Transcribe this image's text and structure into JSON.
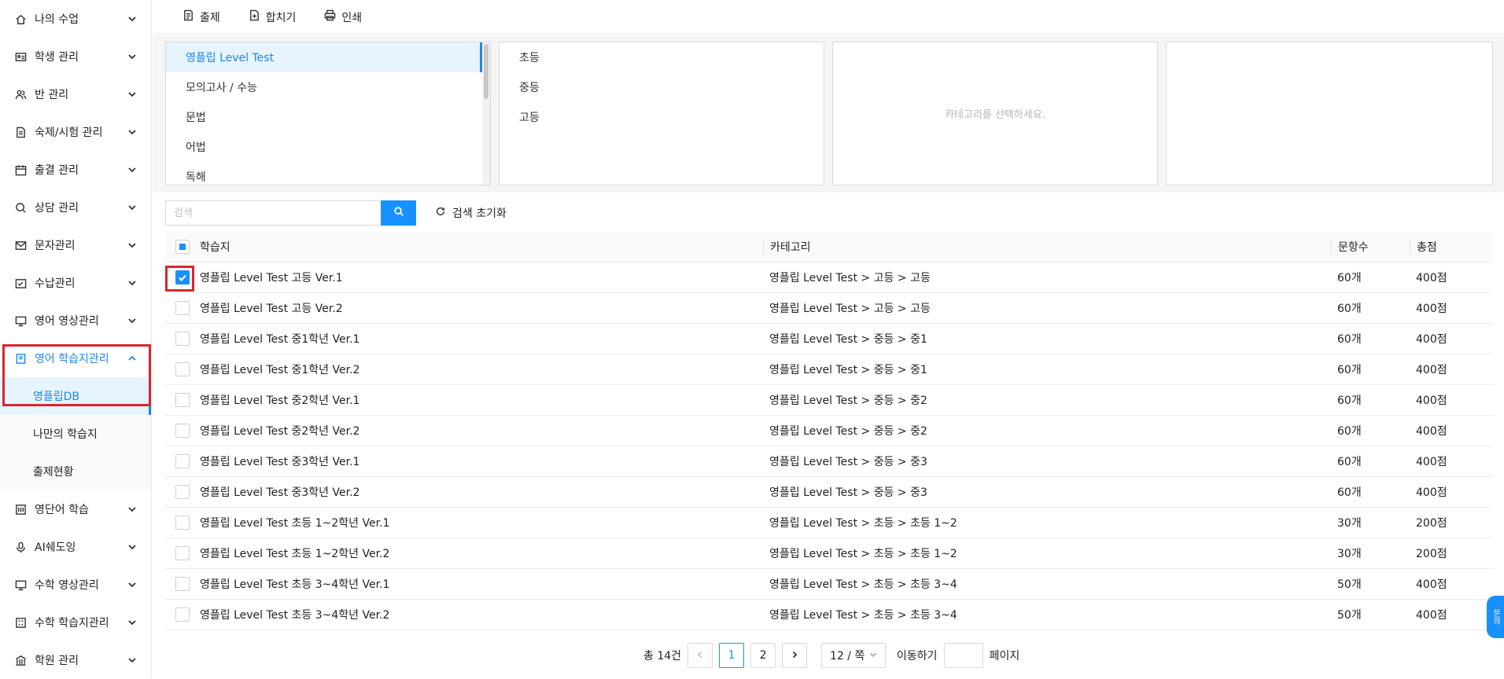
{
  "sidebar": {
    "items": [
      {
        "label": "나의 수업",
        "icon": "home-icon"
      },
      {
        "label": "학생 관리",
        "icon": "id-card-icon"
      },
      {
        "label": "반 관리",
        "icon": "users-icon"
      },
      {
        "label": "숙제/시험 관리",
        "icon": "document-icon"
      },
      {
        "label": "출결 관리",
        "icon": "calendar-icon"
      },
      {
        "label": "상담 관리",
        "icon": "chat-icon"
      },
      {
        "label": "문자관리",
        "icon": "mail-icon"
      },
      {
        "label": "수납관리",
        "icon": "wallet-icon"
      },
      {
        "label": "영어 영상관리",
        "icon": "monitor-icon"
      },
      {
        "label": "영어 학습지관리",
        "icon": "book-icon"
      },
      {
        "label": "영단어 학습",
        "icon": "vocab-icon"
      },
      {
        "label": "AI쉐도잉",
        "icon": "mic-icon"
      },
      {
        "label": "수학 영상관리",
        "icon": "monitor-icon"
      },
      {
        "label": "수학 학습지관리",
        "icon": "calculator-icon"
      },
      {
        "label": "학원 관리",
        "icon": "building-icon"
      }
    ],
    "sub_items": [
      "영플립DB",
      "나만의 학습지",
      "출제현황"
    ]
  },
  "toolbar": {
    "submit_label": "출제",
    "merge_label": "합치기",
    "print_label": "인쇄"
  },
  "categories": {
    "level1": [
      "영플립 Level Test",
      "모의고사 / 수능",
      "문법",
      "어법",
      "독해"
    ],
    "level2": [
      "초등",
      "중등",
      "고등"
    ],
    "empty_message": "카테고리를 선택하세요."
  },
  "search": {
    "placeholder": "검색",
    "reset_label": "검색 초기화"
  },
  "table": {
    "headers": {
      "name": "학습지",
      "category": "카테고리",
      "count": "문항수",
      "score": "총점"
    },
    "rows": [
      {
        "name": "영플립 Level Test 고등 Ver.1",
        "category": "영플립 Level Test > 고등 > 고등",
        "count": "60개",
        "score": "400점",
        "checked": true
      },
      {
        "name": "영플립 Level Test 고등 Ver.2",
        "category": "영플립 Level Test > 고등 > 고등",
        "count": "60개",
        "score": "400점",
        "checked": false
      },
      {
        "name": "영플립 Level Test 중1학년 Ver.1",
        "category": "영플립 Level Test > 중등 > 중1",
        "count": "60개",
        "score": "400점",
        "checked": false
      },
      {
        "name": "영플립 Level Test 중1학년 Ver.2",
        "category": "영플립 Level Test > 중등 > 중1",
        "count": "60개",
        "score": "400점",
        "checked": false
      },
      {
        "name": "영플립 Level Test 중2학년 Ver.1",
        "category": "영플립 Level Test > 중등 > 중2",
        "count": "60개",
        "score": "400점",
        "checked": false
      },
      {
        "name": "영플립 Level Test 중2학년 Ver.2",
        "category": "영플립 Level Test > 중등 > 중2",
        "count": "60개",
        "score": "400점",
        "checked": false
      },
      {
        "name": "영플립 Level Test 중3학년 Ver.1",
        "category": "영플립 Level Test > 중등 > 중3",
        "count": "60개",
        "score": "400점",
        "checked": false
      },
      {
        "name": "영플립 Level Test 중3학년 Ver.2",
        "category": "영플립 Level Test > 중등 > 중3",
        "count": "60개",
        "score": "400점",
        "checked": false
      },
      {
        "name": "영플립 Level Test 초등 1~2학년 Ver.1",
        "category": "영플립 Level Test > 초등 > 초등 1~2",
        "count": "30개",
        "score": "200점",
        "checked": false
      },
      {
        "name": "영플립 Level Test 초등 1~2학년 Ver.2",
        "category": "영플립 Level Test > 초등 > 초등 1~2",
        "count": "30개",
        "score": "200점",
        "checked": false
      },
      {
        "name": "영플립 Level Test 초등 3~4학년 Ver.1",
        "category": "영플립 Level Test > 초등 > 초등 3~4",
        "count": "50개",
        "score": "400점",
        "checked": false
      },
      {
        "name": "영플립 Level Test 초등 3~4학년 Ver.2",
        "category": "영플립 Level Test > 초등 > 초등 3~4",
        "count": "50개",
        "score": "400점",
        "checked": false
      }
    ]
  },
  "pagination": {
    "total": "총 14건",
    "pages": [
      "1",
      "2"
    ],
    "current": "1",
    "page_size": "12 / 쪽",
    "goto_label": "이동하기",
    "page_suffix": "페이지"
  },
  "float_button": {
    "label": "문의"
  },
  "colors": {
    "accent": "#1890ff",
    "highlight": "#d8262d",
    "selected_bg": "#e6f4ff"
  }
}
